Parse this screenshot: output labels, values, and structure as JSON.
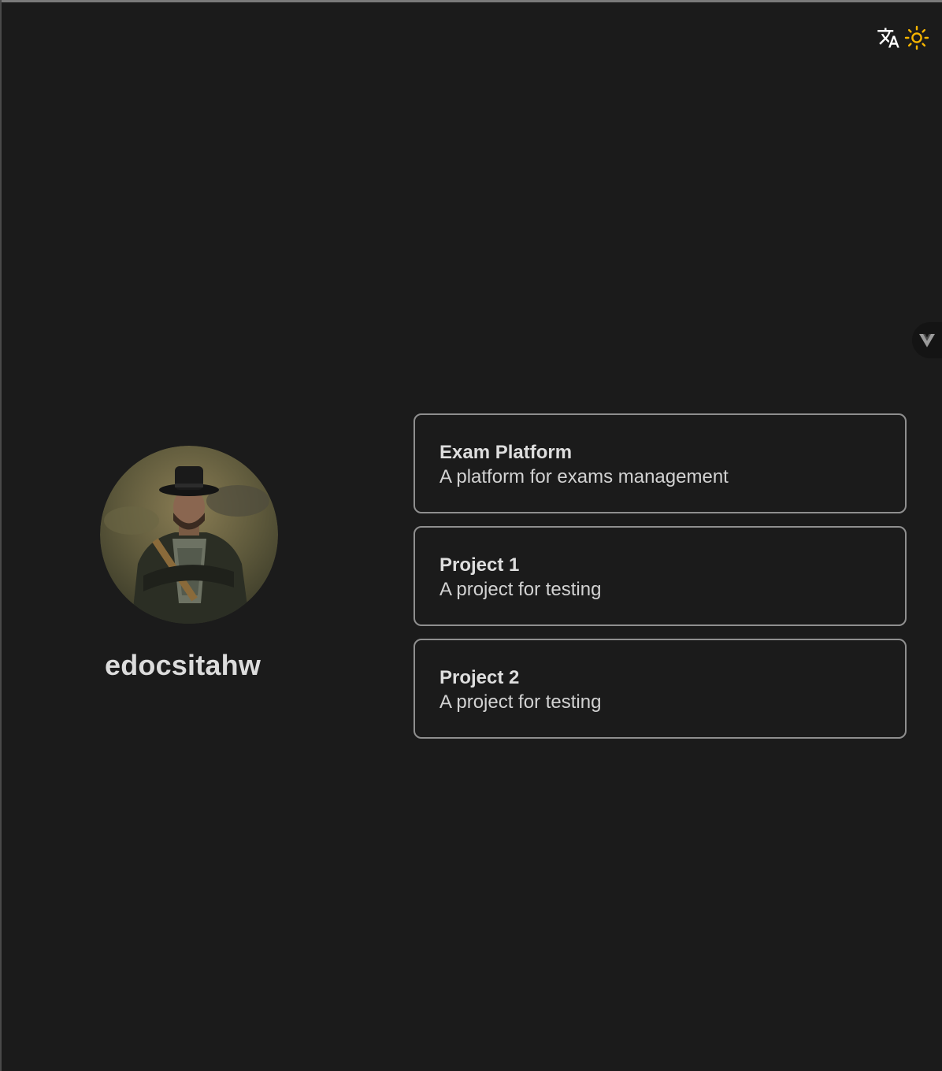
{
  "controls": {
    "translate_icon": "translate-icon",
    "theme_icon": "sun-icon",
    "sun_color": "#f7b500"
  },
  "devtools": {
    "icon": "vue-logo-icon"
  },
  "profile": {
    "username": "edocsitahw",
    "avatar_icon": "avatar-cowboy-portrait"
  },
  "projects": [
    {
      "title": "Exam Platform",
      "description": "A platform for exams management"
    },
    {
      "title": "Project 1",
      "description": "A project for testing"
    },
    {
      "title": "Project 2",
      "description": "A project for testing"
    }
  ],
  "colors": {
    "background": "#1b1b1b",
    "card_border": "#8f8f8f",
    "text": "#d9d9d9"
  }
}
